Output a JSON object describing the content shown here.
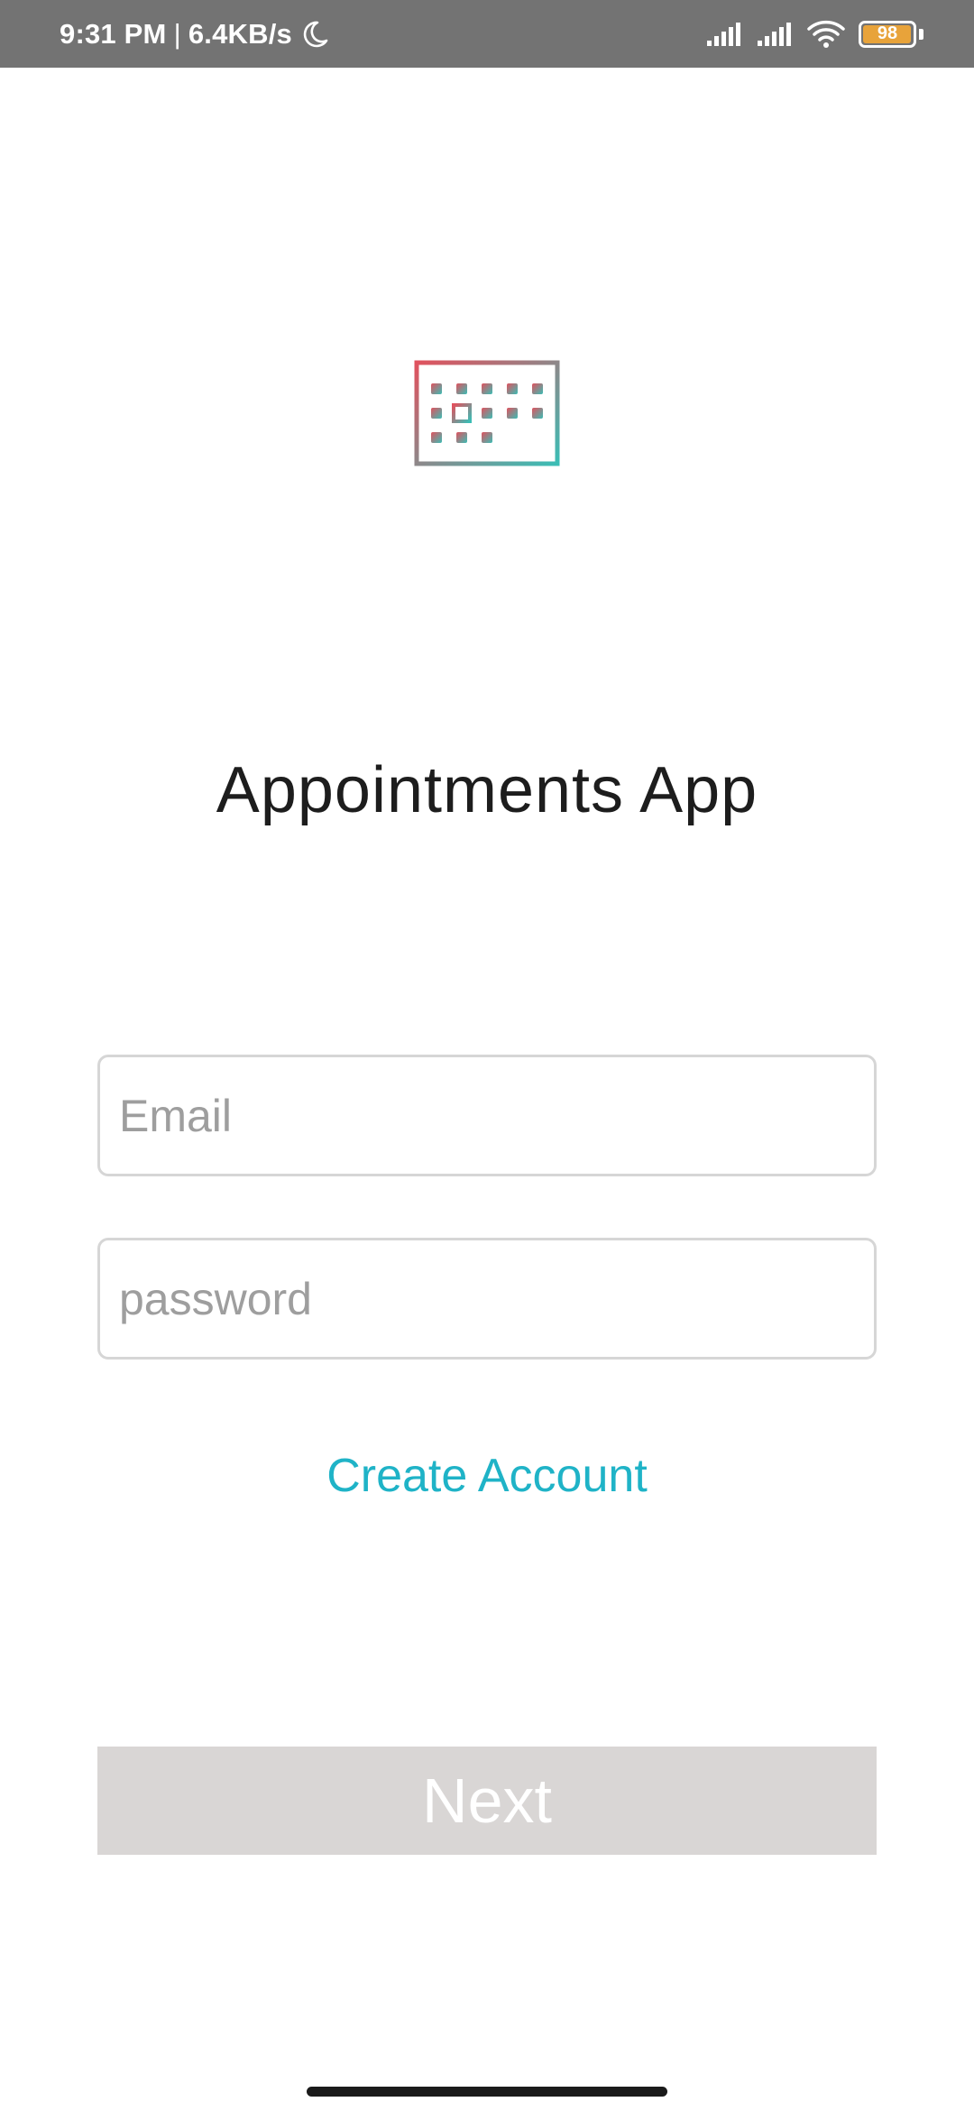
{
  "status_bar": {
    "time": "9:31 PM",
    "separator": "|",
    "network_speed": "6.4KB/s",
    "battery_level": "98",
    "battery_fraction": 0.98,
    "icons": [
      "moon-icon",
      "signal-icon",
      "signal-icon",
      "wifi-icon",
      "battery-icon"
    ],
    "colors": {
      "background": "#737373",
      "battery_fill": "#e8a33a"
    }
  },
  "logo": {
    "icon": "calendar-icon",
    "gradient": [
      "#e0525e",
      "#3bbdb5"
    ]
  },
  "app_title": "Appointments App",
  "form": {
    "email_placeholder": "Email",
    "email_value": "",
    "password_placeholder": "password",
    "password_value": ""
  },
  "create_account_label": "Create Account",
  "next_label": "Next",
  "colors": {
    "link": "#1fb3c7",
    "button_disabled": "#d9d6d5",
    "field_border": "#d6d6d6"
  }
}
